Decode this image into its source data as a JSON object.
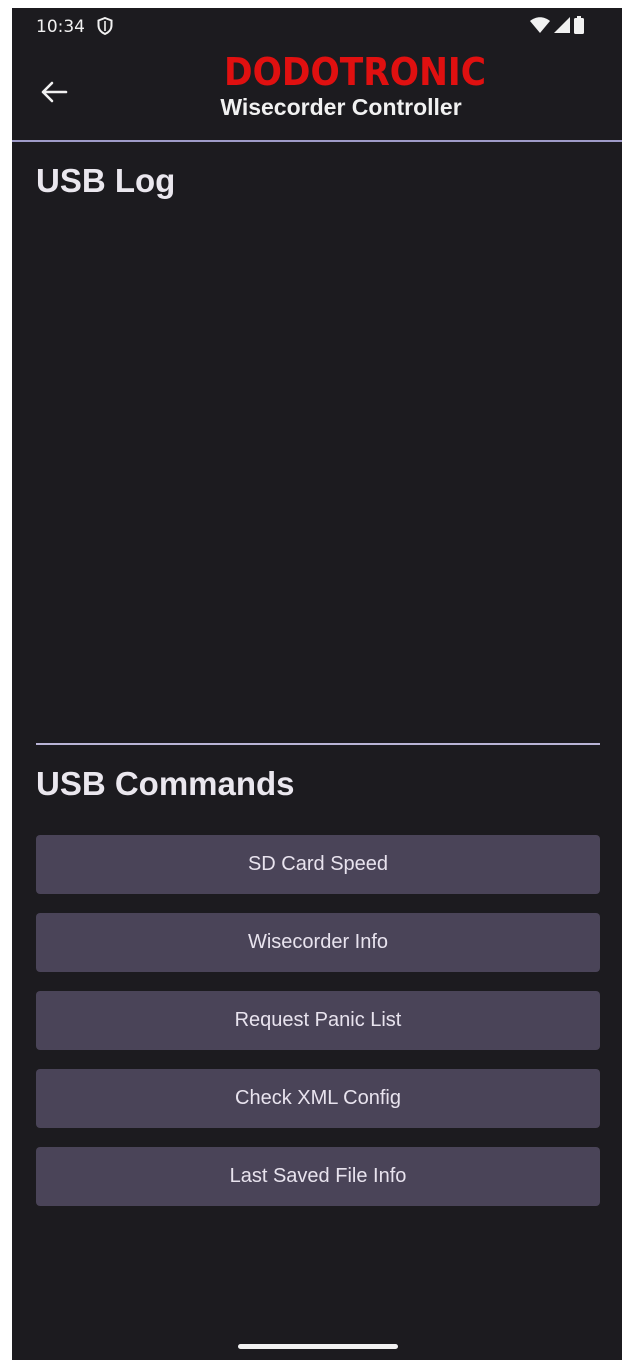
{
  "status_bar": {
    "time": "10:34",
    "icons": [
      "shield-icon",
      "wifi-icon",
      "signal-icon",
      "battery-icon"
    ]
  },
  "app_bar": {
    "back_icon": "arrow-left-icon",
    "logo_text": "DODOTRONIC",
    "logo_color": "#e01010",
    "subtitle": "Wisecorder Controller",
    "divider_color": "#9f9bc8"
  },
  "usb_log": {
    "title": "USB Log"
  },
  "usb_commands": {
    "title": "USB Commands",
    "button_color": "#4a4458",
    "buttons": [
      {
        "label": "SD Card Speed"
      },
      {
        "label": "Wisecorder Info"
      },
      {
        "label": "Request Panic List"
      },
      {
        "label": "Check XML Config"
      },
      {
        "label": "Last Saved File Info"
      }
    ]
  },
  "colors": {
    "background": "#1c1b1f",
    "text": "#e6e1e5"
  }
}
